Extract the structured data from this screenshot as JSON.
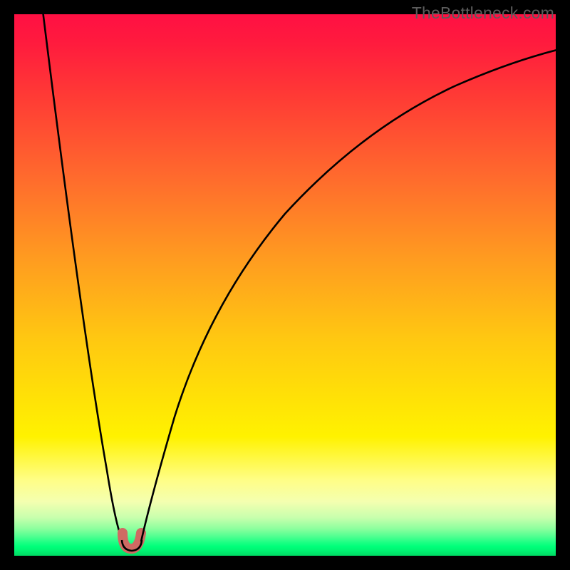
{
  "watermark": "TheBottleneck.com",
  "chart_data": {
    "type": "line",
    "title": "",
    "xlabel": "",
    "ylabel": "",
    "xlim": [
      0,
      100
    ],
    "ylim": [
      0,
      100
    ],
    "background_gradient": {
      "top_color": "#ff1043",
      "mid_color": "#fff200",
      "bottom_color": "#00da63"
    },
    "series": [
      {
        "name": "bottleneck-curve",
        "x": [
          5,
          8,
          12,
          16,
          18,
          20,
          21,
          22,
          23,
          24,
          26,
          30,
          36,
          45,
          55,
          68,
          82,
          95,
          100
        ],
        "values": [
          100,
          78,
          48,
          20,
          8,
          2,
          1,
          1,
          2,
          5,
          14,
          32,
          50,
          65,
          76,
          84,
          89,
          92,
          93
        ]
      }
    ],
    "marker": {
      "name": "optimal-range",
      "x_start": 20,
      "x_end": 23,
      "y": 1,
      "color": "#cf6a63"
    }
  }
}
